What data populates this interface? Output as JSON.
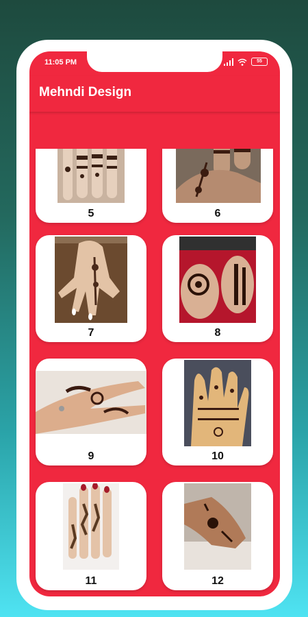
{
  "status_bar": {
    "time": "11:05 PM",
    "icons": [
      "signal-icon",
      "wifi-icon",
      "battery-icon"
    ],
    "battery": "55"
  },
  "app_bar": {
    "title": "Mehndi Design"
  },
  "colors": {
    "primary": "#f0283f",
    "card": "#ffffff",
    "frame": "#ffffff"
  },
  "designs": [
    {
      "number": "5"
    },
    {
      "number": "6"
    },
    {
      "number": "7"
    },
    {
      "number": "8"
    },
    {
      "number": "9"
    },
    {
      "number": "10"
    },
    {
      "number": "11"
    },
    {
      "number": "12"
    }
  ]
}
